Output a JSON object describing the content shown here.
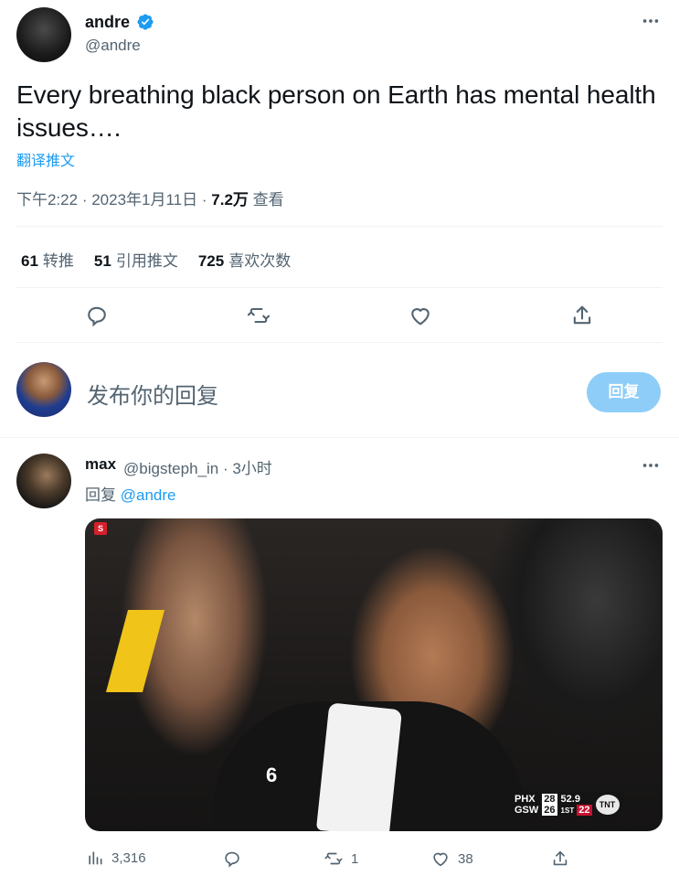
{
  "tweet": {
    "author": {
      "display_name": "andre",
      "handle": "@andre",
      "verified": true
    },
    "text": "Every breathing black person on Earth has mental health issues….",
    "translate_label": "翻译推文",
    "time": "下午2:22",
    "date": "2023年1月11日",
    "views_count": "7.2万",
    "views_label": "查看"
  },
  "stats": [
    {
      "count": "61",
      "label": "转推"
    },
    {
      "count": "51",
      "label": "引用推文"
    },
    {
      "count": "725",
      "label": "喜欢次数"
    }
  ],
  "actions": {
    "reply_icon": "reply-icon",
    "retweet_icon": "retweet-icon",
    "like_icon": "heart-icon",
    "share_icon": "share-icon"
  },
  "composer": {
    "placeholder": "发布你的回复",
    "button_label": "回复"
  },
  "reply_tweet": {
    "display_name": "max",
    "handle": "@bigsteph_in",
    "time_ago": "3小时",
    "replying_label": "回复",
    "replying_to": "@andre",
    "media": {
      "badge": "S",
      "jersey_number": "6",
      "scoreboard": {
        "team1": "PHX",
        "score1": "28",
        "team2": "GSW",
        "score2": "26",
        "clock": "52.9",
        "period": "1ST",
        "shot_clock": "22",
        "network": "TNT"
      }
    },
    "footer": {
      "views": "3,316",
      "replies": "",
      "retweets": "1",
      "likes": "38"
    }
  },
  "colors": {
    "accent": "#1d9bf0",
    "muted": "#536471",
    "divider": "#eff3f4",
    "button_disabled": "#8ecdf8"
  }
}
